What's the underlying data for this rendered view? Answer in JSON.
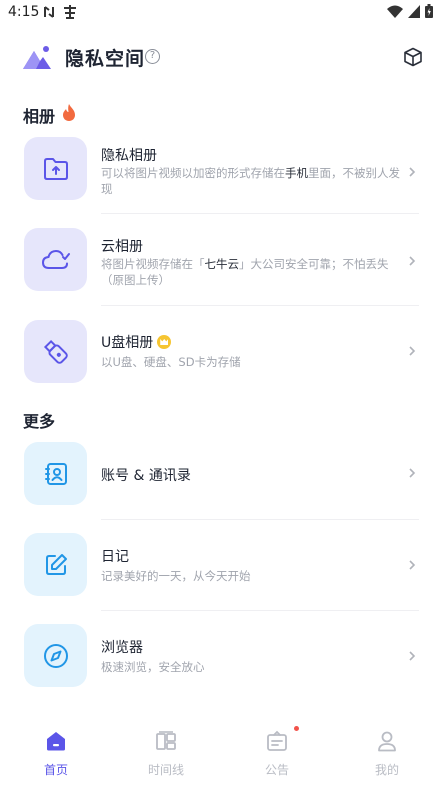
{
  "status_bar": {
    "time": "4:15"
  },
  "header": {
    "title": "隐私空间",
    "help_mark": "?"
  },
  "sections": {
    "album": {
      "title": "相册"
    },
    "more": {
      "title": "更多"
    }
  },
  "album_items": [
    {
      "name": "隐私相册",
      "desc_pre": "可以将图片视频以加密的形式存储在",
      "desc_bold": "手机",
      "desc_post": "里面，不被别人发现"
    },
    {
      "name": "云相册",
      "desc_pre": "将图片视频存储在「",
      "desc_bold": "七牛云",
      "desc_post": "」大公司安全可靠；不怕丢失（原图上传）"
    },
    {
      "name": "U盘相册",
      "desc": "以U盘、硬盘、SD卡为存储"
    }
  ],
  "more_items": [
    {
      "name": "账号 & 通讯录"
    },
    {
      "name": "日记",
      "desc": "记录美好的一天，从今天开始"
    },
    {
      "name": "浏览器",
      "desc": "极速浏览，安全放心"
    }
  ],
  "tabs": [
    {
      "label": "首页",
      "icon": "home-icon",
      "active": true
    },
    {
      "label": "时间线",
      "icon": "timeline-icon"
    },
    {
      "label": "公告",
      "icon": "notice-icon",
      "badge": true
    },
    {
      "label": "我的",
      "icon": "profile-icon"
    }
  ],
  "colors": {
    "accent": "#5b55e8",
    "album_icon_bg": "#e6e6fb",
    "more_icon_bg": "#e3f3fd",
    "album_icon_fg": "#5b55e8",
    "more_icon_fg": "#2196e6",
    "fire": "#f26a3f",
    "badge": "#f2534b"
  }
}
